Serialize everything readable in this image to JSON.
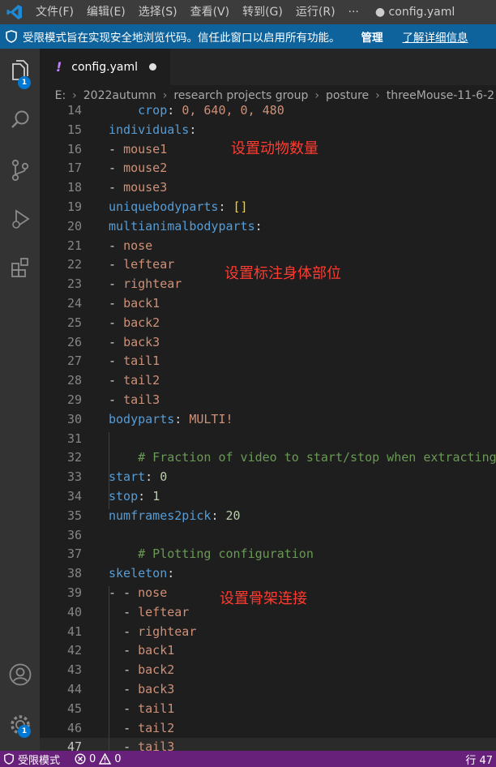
{
  "menu": {
    "items": [
      "文件(F)",
      "编辑(E)",
      "选择(S)",
      "查看(V)",
      "转到(G)",
      "运行(R)"
    ],
    "more": "···",
    "window_title": "● config.yaml"
  },
  "banner": {
    "message": "受限模式旨在实现安全地浏览代码。信任此窗口以启用所有功能。",
    "manage": "管理",
    "learn_more": "了解详细信息"
  },
  "activity": {
    "explorer_badge": "1",
    "settings_badge": "1"
  },
  "tab": {
    "icon_glyph": "!",
    "filename": "config.yaml"
  },
  "breadcrumb": [
    "E:",
    "2022autumn",
    "research projects group",
    "posture",
    "threeMouse-11-6-2"
  ],
  "editor": {
    "lines": [
      {
        "num": "14",
        "indent": "    ",
        "key": "crop",
        "sep": ": ",
        "value": "0, 640, 0, 480",
        "vclass": "v"
      },
      {
        "num": "15",
        "key": "individuals",
        "sep": ":"
      },
      {
        "num": "16",
        "dash": "- ",
        "value": "mouse1",
        "vclass": "v"
      },
      {
        "num": "17",
        "dash": "- ",
        "value": "mouse2",
        "vclass": "v"
      },
      {
        "num": "18",
        "dash": "- ",
        "value": "mouse3",
        "vclass": "v"
      },
      {
        "num": "19",
        "key": "uniquebodyparts",
        "sep": ": ",
        "value": "[]",
        "vclass": "br"
      },
      {
        "num": "20",
        "key": "multianimalbodyparts",
        "sep": ":"
      },
      {
        "num": "21",
        "dash": "- ",
        "value": "nose",
        "vclass": "v"
      },
      {
        "num": "22",
        "dash": "- ",
        "value": "leftear",
        "vclass": "v"
      },
      {
        "num": "23",
        "dash": "- ",
        "value": "rightear",
        "vclass": "v"
      },
      {
        "num": "24",
        "dash": "- ",
        "value": "back1",
        "vclass": "v"
      },
      {
        "num": "25",
        "dash": "- ",
        "value": "back2",
        "vclass": "v"
      },
      {
        "num": "26",
        "dash": "- ",
        "value": "back3",
        "vclass": "v"
      },
      {
        "num": "27",
        "dash": "- ",
        "value": "tail1",
        "vclass": "v"
      },
      {
        "num": "28",
        "dash": "- ",
        "value": "tail2",
        "vclass": "v"
      },
      {
        "num": "29",
        "dash": "- ",
        "value": "tail3",
        "vclass": "v"
      },
      {
        "num": "30",
        "key": "bodyparts",
        "sep": ": ",
        "value": "MULTI!",
        "vclass": "v"
      },
      {
        "num": "31"
      },
      {
        "num": "32",
        "indent": "    ",
        "comment": "# Fraction of video to start/stop when extracting frames"
      },
      {
        "num": "33",
        "key": "start",
        "sep": ": ",
        "value": "0",
        "vclass": "n"
      },
      {
        "num": "34",
        "key": "stop",
        "sep": ": ",
        "value": "1",
        "vclass": "n"
      },
      {
        "num": "35",
        "key": "numframes2pick",
        "sep": ": ",
        "value": "20",
        "vclass": "n"
      },
      {
        "num": "36"
      },
      {
        "num": "37",
        "indent": "    ",
        "comment": "# Plotting configuration"
      },
      {
        "num": "38",
        "key": "skeleton",
        "sep": ":"
      },
      {
        "num": "39",
        "dash": "- - ",
        "value": "nose",
        "vclass": "v"
      },
      {
        "num": "40",
        "indent": "  ",
        "dash": "- ",
        "value": "leftear",
        "vclass": "v"
      },
      {
        "num": "41",
        "indent": "  ",
        "dash": "- ",
        "value": "rightear",
        "vclass": "v"
      },
      {
        "num": "42",
        "indent": "  ",
        "dash": "- ",
        "value": "back1",
        "vclass": "v"
      },
      {
        "num": "43",
        "indent": "  ",
        "dash": "- ",
        "value": "back2",
        "vclass": "v"
      },
      {
        "num": "44",
        "indent": "  ",
        "dash": "- ",
        "value": "back3",
        "vclass": "v"
      },
      {
        "num": "45",
        "indent": "  ",
        "dash": "- ",
        "value": "tail1",
        "vclass": "v"
      },
      {
        "num": "46",
        "indent": "  ",
        "dash": "- ",
        "value": "tail2",
        "vclass": "v"
      },
      {
        "num": "47",
        "indent": "  ",
        "dash": "- ",
        "value": "tail3",
        "vclass": "v",
        "current": true
      }
    ]
  },
  "annotations": {
    "animals": "设置动物数量",
    "bodyparts": "设置标注身体部位",
    "skeleton": "设置骨架连接"
  },
  "status": {
    "restricted_mode": "受限模式",
    "errors": "0",
    "warnings": "0",
    "line_col": "行 47"
  }
}
